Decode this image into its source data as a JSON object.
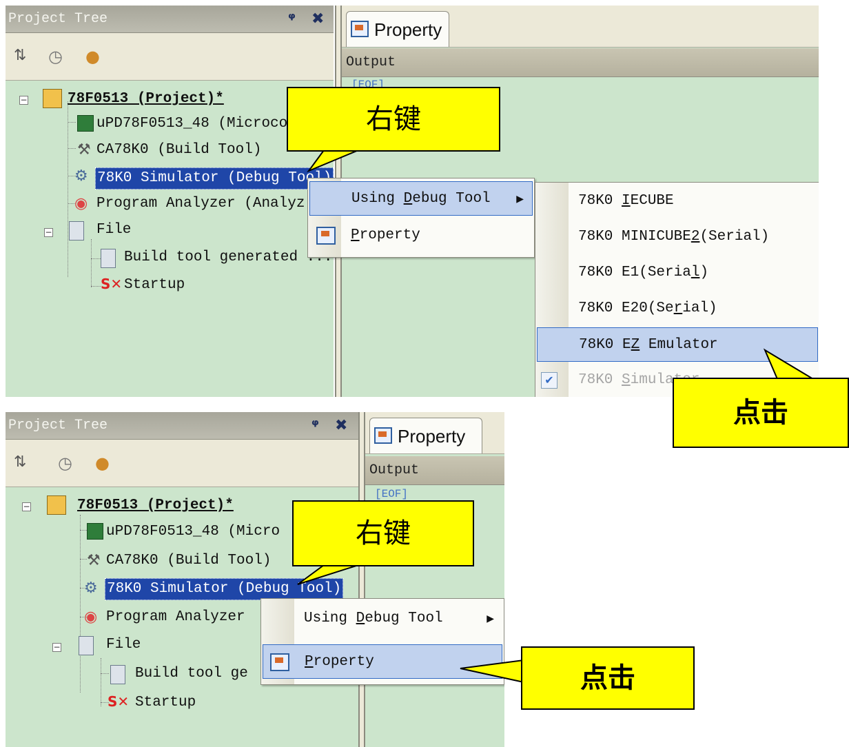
{
  "top": {
    "tree_title": "Project Tree",
    "pin": "ᩪ",
    "close": "✖",
    "tab_property": "Property",
    "output_label": "Output",
    "eof_text": "[EOF]",
    "tree": [
      "78F0513 (Project)*",
      "uPD78F0513_48 (Microco",
      "CA78K0 (Build Tool)",
      "78K0 Simulator (Debug Tool)",
      "Program Analyzer (Analyz",
      "File",
      "Build tool generated ...",
      "Startup"
    ],
    "menu": {
      "using_pre": "Using ",
      "using_u": "D",
      "using_post": "ebug Tool",
      "prop_u": "P",
      "prop_post": "roperty"
    },
    "submenu": [
      {
        "pre": "78K0 ",
        "u": "I",
        "post": "ECUBE"
      },
      {
        "pre": "78K0 MINICUBE",
        "u": "2",
        "post": "(Serial)"
      },
      {
        "pre": "78K0 E1(Seria",
        "u": "l",
        "post": ")"
      },
      {
        "pre": "78K0 E20(Se",
        "u": "r",
        "post": "ial)"
      },
      {
        "pre": "78K0 E",
        "u": "Z",
        "post": " Emulator"
      },
      {
        "pre": "78K0 ",
        "u": "S",
        "post": "imulator"
      }
    ],
    "callout_right": "右键",
    "callout_click": "点击"
  },
  "bottom": {
    "tree_title": "Project Tree",
    "tab_property": "Property",
    "output_label": "Output",
    "eof_text": "[EOF]",
    "tree": [
      "78F0513 (Project)*",
      "uPD78F0513_48 (Micro",
      "CA78K0 (Build Tool)",
      "78K0 Simulator (Debug Tool)",
      "Program Analyzer",
      "File",
      "Build tool ge",
      "Startup"
    ],
    "menu": {
      "using_pre": "Using ",
      "using_u": "D",
      "using_post": "ebug Tool",
      "prop_u": "P",
      "prop_post": "roperty"
    },
    "callout_right": "右键",
    "callout_click": "点击"
  },
  "colors": {
    "tree_bg": "#cce5cc",
    "selection": "#1f46a8",
    "menu_highlight": "#c1d2ee",
    "callout": "#ffff00"
  }
}
